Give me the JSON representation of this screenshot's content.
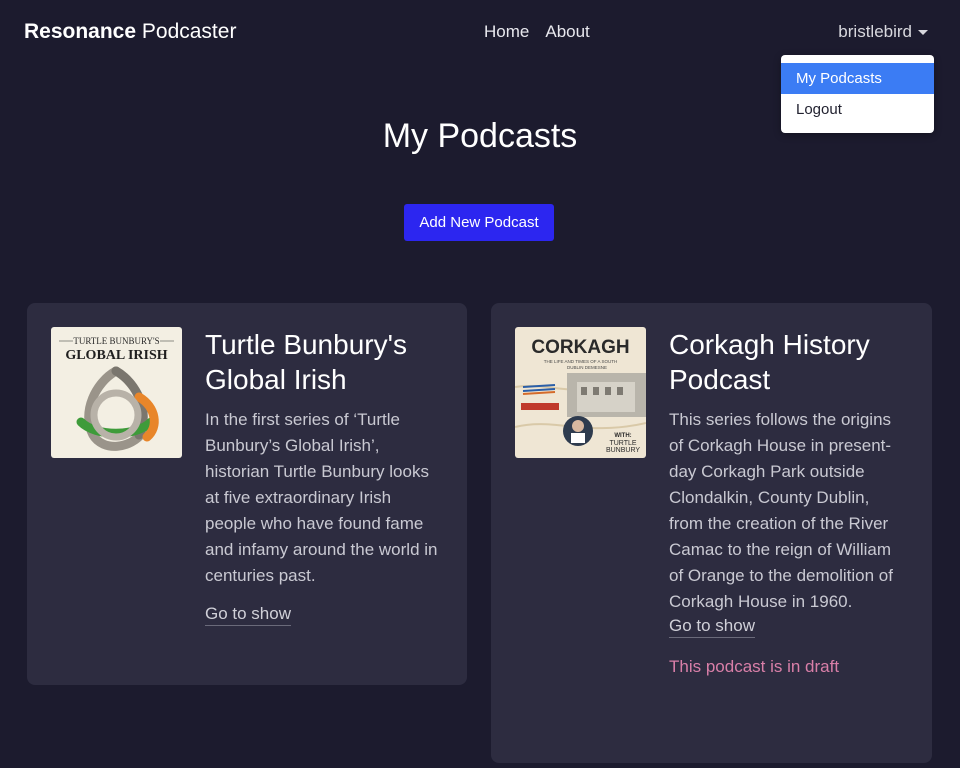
{
  "nav": {
    "brand_bold": "Resonance",
    "brand_light": " Podcaster",
    "links": [
      "Home",
      "About"
    ],
    "user": "bristlebird",
    "dropdown": [
      "My Podcasts",
      "Logout"
    ]
  },
  "main": {
    "title": "My Podcasts",
    "add_button": "Add New Podcast"
  },
  "podcasts": [
    {
      "title": "Turtle Bunbury's Global Irish",
      "description": "In the first series of ‘Turtle Bunbury’s Global Irish’, historian Turtle Bunbury looks at five extraordinary Irish people who have found fame and infamy around the world in centuries past.",
      "link": "Go to show",
      "cover_text_1": "TURTLE BUNBURY'S",
      "cover_text_2": "GLOBAL IRISH"
    },
    {
      "title": "Corkagh History Podcast",
      "description": "This series follows the origins of Corkagh House in present-day Corkagh Park outside Clondalkin, County Dublin, from the creation of the River Camac to the reign of William of Orange to the demolition of Corkagh House in 1960.",
      "link": "Go to show",
      "status": "This podcast is in draft",
      "cover_text_1": "CORKAGH",
      "cover_text_2": "THE LIFE AND TIMES OF A SOUTH",
      "cover_text_3": "DUBLIN DEMESNE",
      "cover_text_4": "WITH:",
      "cover_text_5": "TURTLE",
      "cover_text_6": "BUNBURY"
    }
  ],
  "colors": {
    "background": "#1c1b2e",
    "card": "#2d2c40",
    "primary_button": "#2c26f0",
    "dropdown_active": "#3b7cf4",
    "draft_text": "#d97fa8"
  }
}
